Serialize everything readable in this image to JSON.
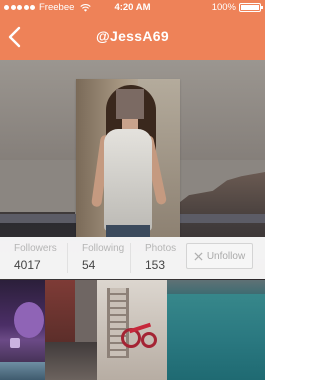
{
  "status_bar": {
    "carrier": "Freebee",
    "time": "4:20 AM",
    "battery": "100%",
    "battery_level": 1.0
  },
  "nav": {
    "title": "@JessA69",
    "back_icon": "chevron-left-icon"
  },
  "colors": {
    "accent": "#ee8258",
    "stat_label": "#b5b5b5",
    "stat_value": "#444444",
    "button_text": "#aaaaaa"
  },
  "stats": [
    {
      "label": "Followers",
      "value": "4017"
    },
    {
      "label": "Following",
      "value": "54"
    },
    {
      "label": "Photos",
      "value": "153"
    }
  ],
  "unfollow": {
    "label": "Unfollow",
    "icon": "close-icon"
  }
}
